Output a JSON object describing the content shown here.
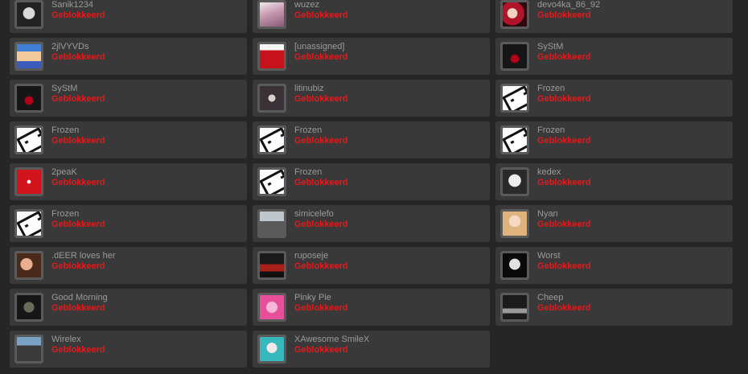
{
  "status_label": "Geblokkeerd",
  "colors": {
    "page_background": "#262626",
    "card_background": "#393939",
    "name_text": "#9a9a9a",
    "status_text": "#e8171a"
  },
  "friends": [
    {
      "name": "Sanik1234",
      "status": "Geblokkeerd",
      "avatar": "skull-avatar"
    },
    {
      "name": "wuzez",
      "status": "Geblokkeerd",
      "avatar": "anime-girl-avatar"
    },
    {
      "name": "devo4ka_86_92",
      "status": "Geblokkeerd",
      "avatar": "portrait-avatar"
    },
    {
      "name": "2jlVYVDs",
      "status": "Geblokkeerd",
      "avatar": "blocky-character-avatar"
    },
    {
      "name": "[unassigned]",
      "status": "Geblokkeerd",
      "avatar": "red-cartoon-avatar"
    },
    {
      "name": "SyStM",
      "status": "Geblokkeerd",
      "avatar": "hooded-figures-avatar"
    },
    {
      "name": "SyStM",
      "status": "Geblokkeerd",
      "avatar": "hooded-figures-avatar"
    },
    {
      "name": "litinubiz",
      "status": "Geblokkeerd",
      "avatar": "cat-avatar"
    },
    {
      "name": "Frozen",
      "status": "Geblokkeerd",
      "avatar": "cube-face-avatar"
    },
    {
      "name": "Frozen",
      "status": "Geblokkeerd",
      "avatar": "cube-face-avatar"
    },
    {
      "name": "Frozen",
      "status": "Geblokkeerd",
      "avatar": "cube-face-avatar"
    },
    {
      "name": "Frozen",
      "status": "Geblokkeerd",
      "avatar": "cube-face-avatar"
    },
    {
      "name": "2peaK",
      "status": "Geblokkeerd",
      "avatar": "red-wolf-avatar"
    },
    {
      "name": "Frozen",
      "status": "Geblokkeerd",
      "avatar": "cube-face-avatar"
    },
    {
      "name": "kedex",
      "status": "Geblokkeerd",
      "avatar": "joker-avatar"
    },
    {
      "name": "Frozen",
      "status": "Geblokkeerd",
      "avatar": "cube-face-avatar"
    },
    {
      "name": "simicelefo",
      "status": "Geblokkeerd",
      "avatar": "street-photo-avatar"
    },
    {
      "name": "Nyan",
      "status": "Geblokkeerd",
      "avatar": "anime-avatar"
    },
    {
      "name": ".dEER loves her",
      "status": "Geblokkeerd",
      "avatar": "couple-photo-avatar"
    },
    {
      "name": "ruposeje",
      "status": "Geblokkeerd",
      "avatar": "car-avatar"
    },
    {
      "name": "Worst",
      "status": "Geblokkeerd",
      "avatar": "ghost-mask-avatar"
    },
    {
      "name": "Good Morning",
      "status": "Geblokkeerd",
      "avatar": "soldier-avatar"
    },
    {
      "name": "Pinky Pie",
      "status": "Geblokkeerd",
      "avatar": "pink-pony-avatar"
    },
    {
      "name": "Cheep",
      "status": "Geblokkeerd",
      "avatar": "mw3-logo-avatar"
    },
    {
      "name": "Wirelex",
      "status": "Geblokkeerd",
      "avatar": "battlefield-avatar"
    },
    {
      "name": "XAwesome SmileX",
      "status": "Geblokkeerd",
      "avatar": "anime-character-avatar"
    }
  ]
}
